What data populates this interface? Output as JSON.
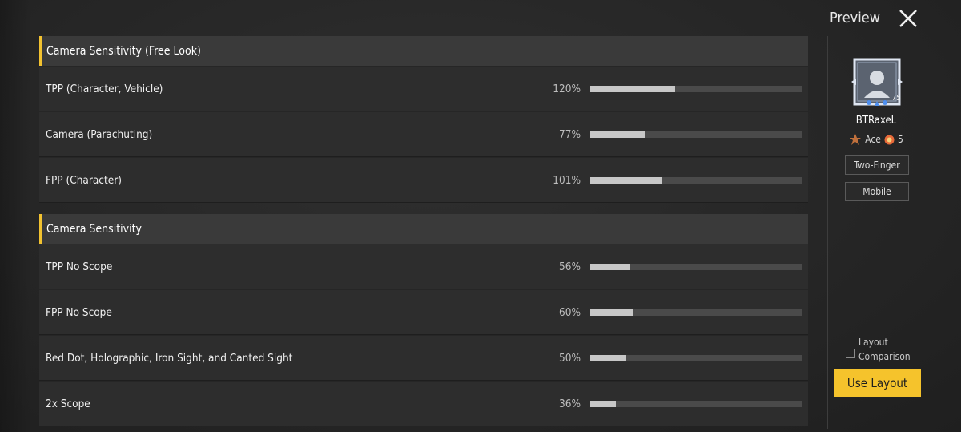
{
  "sections": [
    {
      "title": "Camera Sensitivity (Free Look)",
      "rows": [
        {
          "label": "TPP (Character, Vehicle)",
          "value": "120%",
          "fill": 0.4
        },
        {
          "label": "Camera (Parachuting)",
          "value": "77%",
          "fill": 0.26
        },
        {
          "label": "FPP (Character)",
          "value": "101%",
          "fill": 0.34
        }
      ]
    },
    {
      "title": "Camera Sensitivity",
      "rows": [
        {
          "label": "TPP No Scope",
          "value": "56%",
          "fill": 0.19
        },
        {
          "label": "FPP No Scope",
          "value": "60%",
          "fill": 0.2
        },
        {
          "label": "Red Dot, Holographic, Iron Sight, and Canted Sight",
          "value": "50%",
          "fill": 0.17
        },
        {
          "label": "2x Scope",
          "value": "36%",
          "fill": 0.12
        }
      ]
    }
  ],
  "sidebar": {
    "title": "Preview",
    "close_icon": "close-icon",
    "username": "BTRaxeL",
    "avatar_level": "75",
    "rank_name": "Ace",
    "rank_level": "5",
    "tag_control": "Two-Finger",
    "tag_device": "Mobile",
    "compare_label": "Layout Comparison",
    "use_button": "Use Layout"
  },
  "colors": {
    "accent": "#f5c32c",
    "bar_fill": "#c7c7c7",
    "bar_track": "#4a4a4a"
  }
}
